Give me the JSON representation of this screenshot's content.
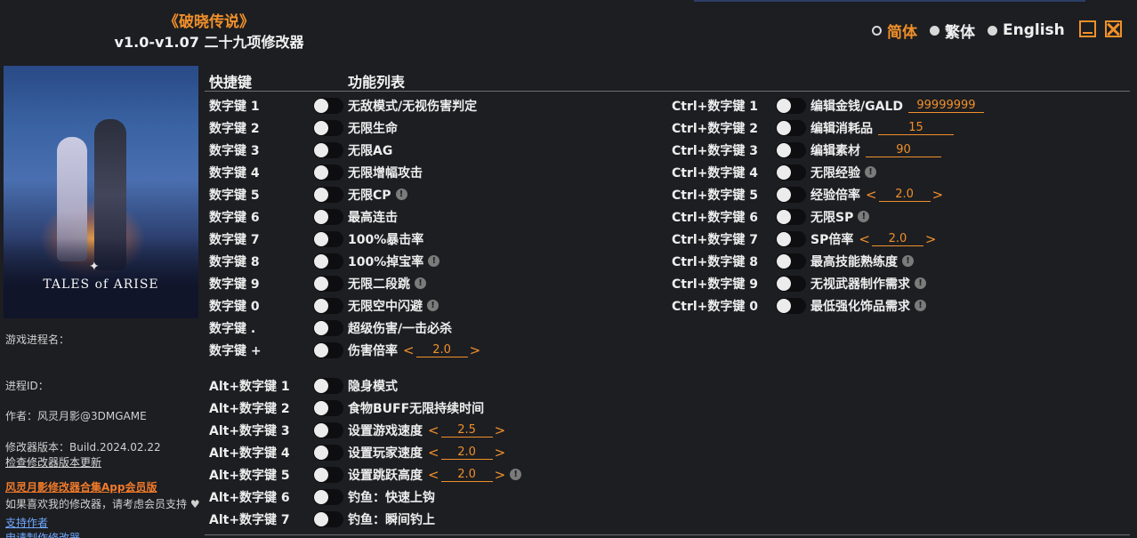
{
  "header": {
    "game_title": "《破晓传说》",
    "subtitle": "v1.0-v1.07 二十九项修改器"
  },
  "languages": [
    {
      "label": "简体",
      "active": true
    },
    {
      "label": "繁体",
      "active": false
    },
    {
      "label": "English",
      "active": false
    }
  ],
  "cover": {
    "logo_text": "TALES of ARISE",
    "logo_mark": "✦"
  },
  "sidebar": {
    "process_name_label": "游戏进程名：",
    "process_id_label": "进程ID：",
    "author": "作者：风灵月影@3DMGAME",
    "version": "修改器版本：Build.2024.02.22",
    "check_update": "检查修改器版本更新",
    "vip_link": "风灵月影修改器合集App会员版",
    "support_text": "如果喜欢我的修改器，请考虑会员支持 ♥",
    "support_author": "支持作者",
    "custom_trainer": "申请制作修改器"
  },
  "columns": {
    "hotkey": "快捷键",
    "features": "功能列表"
  },
  "left_options": [
    {
      "key": "数字键 1",
      "label": "无敌模式/无视伤害判定"
    },
    {
      "key": "数字键 2",
      "label": "无限生命"
    },
    {
      "key": "数字键 3",
      "label": "无限AG"
    },
    {
      "key": "数字键 4",
      "label": "无限增幅攻击"
    },
    {
      "key": "数字键 5",
      "label": "无限CP",
      "info": true
    },
    {
      "key": "数字键 6",
      "label": "最高连击"
    },
    {
      "key": "数字键 7",
      "label": "100%暴击率"
    },
    {
      "key": "数字键 8",
      "label": "100%掉宝率",
      "info": true
    },
    {
      "key": "数字键 9",
      "label": "无限二段跳",
      "info": true
    },
    {
      "key": "数字键 0",
      "label": "无限空中闪避",
      "info": true
    },
    {
      "key": "数字键 .",
      "label": "超级伤害/一击必杀"
    },
    {
      "key": "数字键 +",
      "label": "伤害倍率",
      "stepper": "2.0"
    },
    {
      "key": "Alt+数字键 1",
      "label": "隐身模式"
    },
    {
      "key": "Alt+数字键 2",
      "label": "食物BUFF无限持续时间"
    },
    {
      "key": "Alt+数字键 3",
      "label": "设置游戏速度",
      "stepper": "2.5"
    },
    {
      "key": "Alt+数字键 4",
      "label": "设置玩家速度",
      "stepper": "2.0"
    },
    {
      "key": "Alt+数字键 5",
      "label": "设置跳跃高度",
      "stepper": "2.0",
      "info": true
    },
    {
      "key": "Alt+数字键 6",
      "label": "钓鱼：快速上钩"
    },
    {
      "key": "Alt+数字键 7",
      "label": "钓鱼：瞬间钓上"
    }
  ],
  "right_options": [
    {
      "key": "Ctrl+数字键 1",
      "label": "编辑金钱/GALD",
      "edit": "99999999"
    },
    {
      "key": "Ctrl+数字键 2",
      "label": "编辑消耗品",
      "edit": "15"
    },
    {
      "key": "Ctrl+数字键 3",
      "label": "编辑素材",
      "edit": "90"
    },
    {
      "key": "Ctrl+数字键 4",
      "label": "无限经验",
      "info": true
    },
    {
      "key": "Ctrl+数字键 5",
      "label": "经验倍率",
      "stepper": "2.0"
    },
    {
      "key": "Ctrl+数字键 6",
      "label": "无限SP",
      "info": true
    },
    {
      "key": "Ctrl+数字键 7",
      "label": "SP倍率",
      "stepper": "2.0"
    },
    {
      "key": "Ctrl+数字键 8",
      "label": "最高技能熟练度",
      "info": true
    },
    {
      "key": "Ctrl+数字键 9",
      "label": "无视武器制作需求",
      "info": true
    },
    {
      "key": "Ctrl+数字键 0",
      "label": "最低强化饰品需求",
      "info": true
    }
  ],
  "glyphs": {
    "left_arrow": "<",
    "right_arrow": ">",
    "info": "!"
  },
  "colors": {
    "accent": "#f0902a",
    "background": "#1d1e22",
    "link": "#6ea8ff"
  }
}
